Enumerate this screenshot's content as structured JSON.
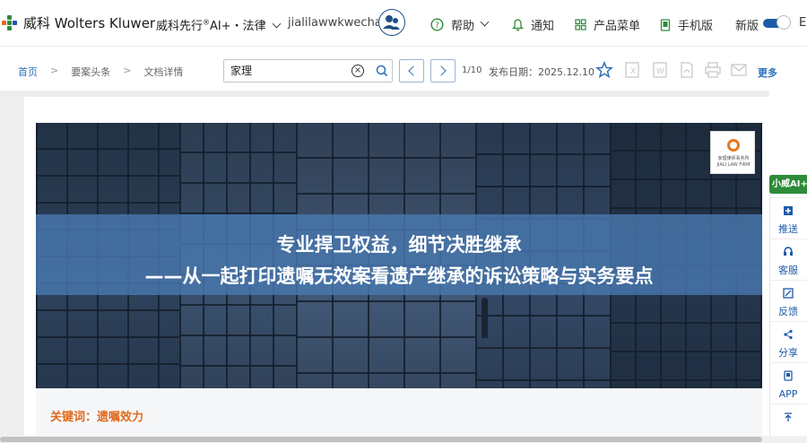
{
  "header": {
    "brand": "威科 Wolters Kluwer",
    "product": "威科先行",
    "product_suffix": "AI+・法律",
    "product_reg": "®",
    "username": "jialilawwkwechat",
    "nav": [
      {
        "label": "帮助",
        "icon": "help-icon"
      },
      {
        "label": "通知",
        "icon": "bell-icon"
      },
      {
        "label": "产品菜单",
        "icon": "grid-icon"
      },
      {
        "label": "手机版",
        "icon": "phone-icon"
      }
    ],
    "new_version_label": "新版",
    "lang_label": "EN",
    "colors": {
      "brand_green": "#2e8b3a",
      "brand_blue": "#1d5aa8",
      "accent_orange": "#e06a1c"
    }
  },
  "toolbar": {
    "breadcrumb": [
      "首页",
      "要案头条",
      "文档详情"
    ],
    "search_value": "家理",
    "pager": "1/10",
    "publish_date": "发布日期：2025.12.10",
    "more_label": "更多"
  },
  "article": {
    "banner_line1": "专业捍卫权益，细节决胜继承",
    "banner_line2": "——从一起打印遗嘱无效案看遗产继承的诉讼策略与实务要点",
    "badge_text": "家理律师事务所",
    "badge_sub": "JIALI LAW FIRM",
    "keywords": "关键词：遗嘱效力"
  },
  "sidebar": {
    "ai_label": "小威AI+",
    "items": [
      {
        "label": "推送",
        "icon": "push-icon"
      },
      {
        "label": "客服",
        "icon": "headset-icon"
      },
      {
        "label": "反馈",
        "icon": "feedback-icon"
      },
      {
        "label": "分享",
        "icon": "share-icon"
      },
      {
        "label": "APP",
        "icon": "app-icon"
      },
      {
        "label": "",
        "icon": "back-to-top-icon"
      }
    ]
  }
}
